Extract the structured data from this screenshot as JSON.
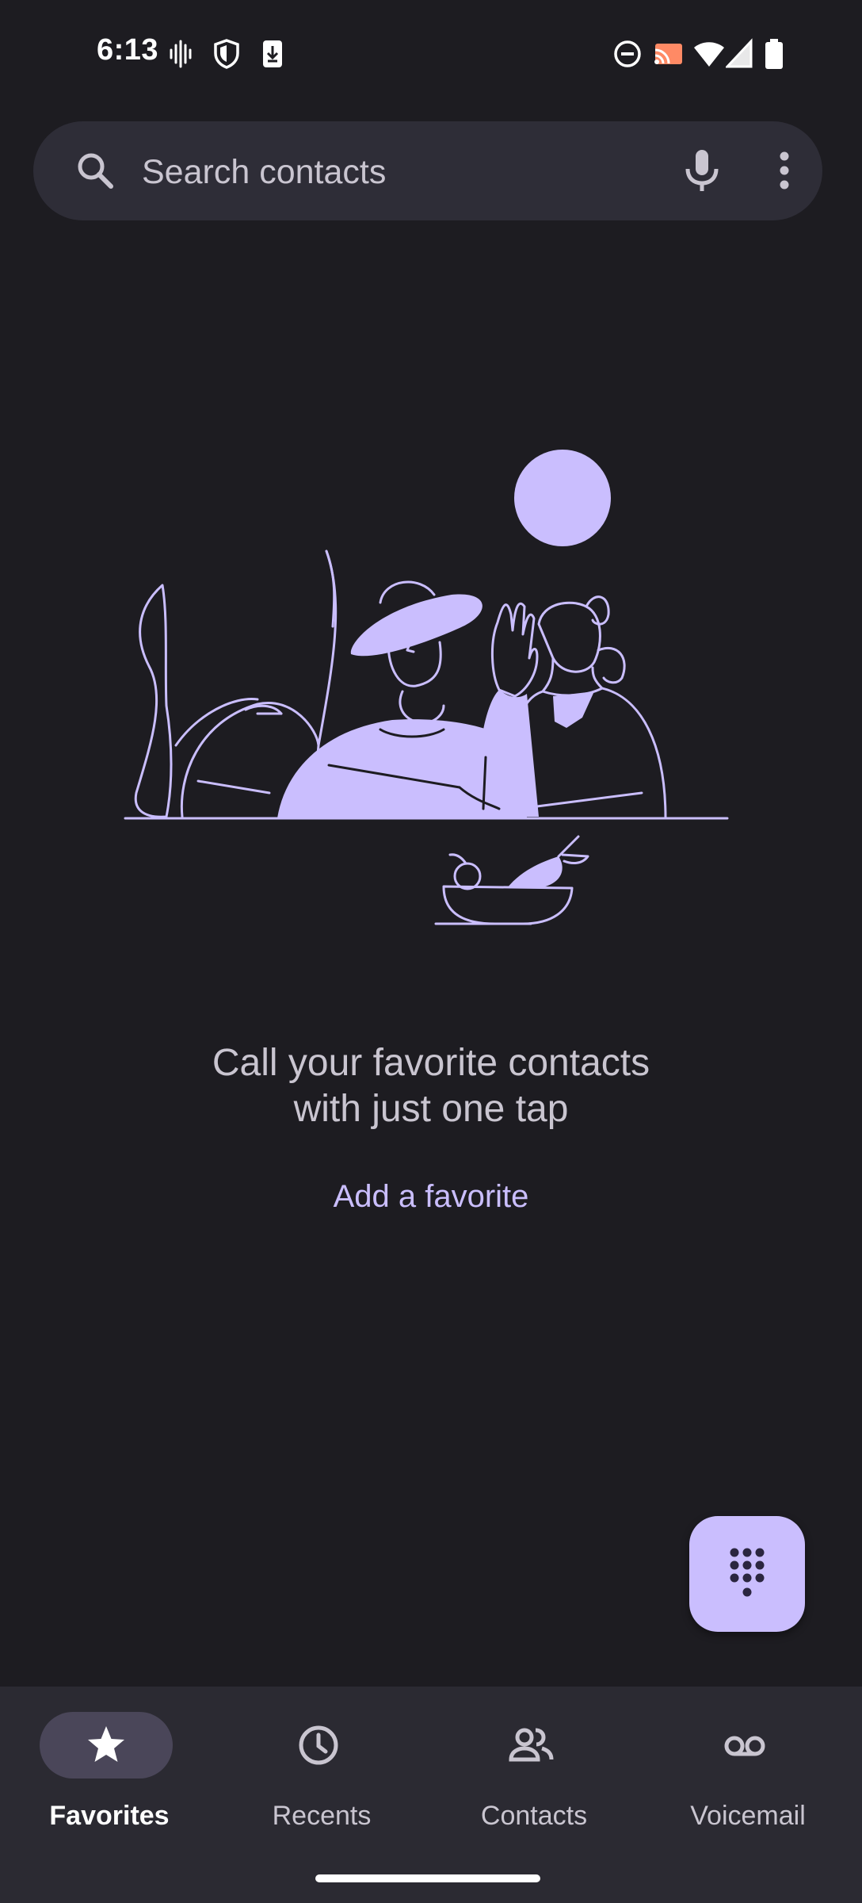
{
  "status_bar": {
    "time": "6:13",
    "icons": [
      "voice-wave-icon",
      "shield-icon",
      "download-icon",
      "do-not-disturb-icon",
      "cast-icon",
      "wifi-icon",
      "cell-signal-icon",
      "battery-icon"
    ]
  },
  "search": {
    "placeholder": "Search contacts",
    "icons": [
      "search-icon",
      "microphone-icon",
      "more-vert-icon"
    ]
  },
  "empty_state": {
    "message_line1": "Call your favorite contacts",
    "message_line2": "with just one tap",
    "action_label": "Add a favorite"
  },
  "fab": {
    "icon": "dialpad-icon"
  },
  "bottom_nav": {
    "items": [
      {
        "label": "Favorites",
        "icon": "star-icon",
        "active": true
      },
      {
        "label": "Recents",
        "icon": "clock-icon",
        "active": false
      },
      {
        "label": "Contacts",
        "icon": "people-icon",
        "active": false
      },
      {
        "label": "Voicemail",
        "icon": "voicemail-icon",
        "active": false
      }
    ]
  },
  "colors": {
    "background": "#1d1c21",
    "search_bar": "#2e2d37",
    "accent": "#cabefe",
    "nav_background": "#2b2a32",
    "active_pill": "#4a4659",
    "secondary_text": "#c9c5d0"
  }
}
